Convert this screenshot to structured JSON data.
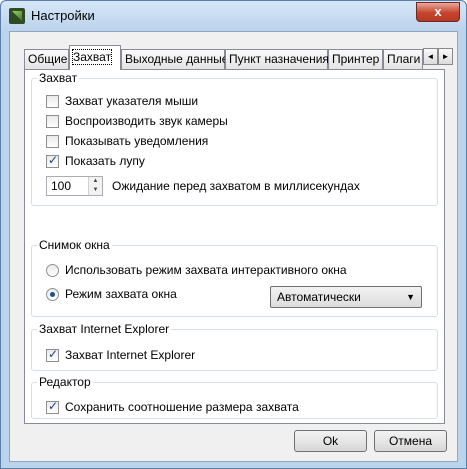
{
  "window": {
    "title": "Настройки",
    "close_glyph": "x"
  },
  "tabs": [
    "Общие",
    "Захват",
    "Выходные данные",
    "Пункт назначения",
    "Принтер",
    "Плаги"
  ],
  "tab_scroll": {
    "left": "◄",
    "right": "►"
  },
  "capture": {
    "label": "Захват",
    "options": [
      "Захват указателя мыши",
      "Воспроизводить звук камеры",
      "Показывать уведомления",
      "Показать лупу"
    ],
    "checked": [
      false,
      false,
      false,
      true
    ],
    "delay_value": "100",
    "delay_label": "Ожидание перед захватом в миллисекундах"
  },
  "window_capture": {
    "label": "Снимок окна",
    "radio1": "Использовать режим захвата интерактивного окна",
    "radio2": "Режим захвата окна",
    "mode_value": "Автоматически"
  },
  "ie_capture": {
    "label": "Захват Internet Explorer",
    "option": "Захват Internet Explorer"
  },
  "editor": {
    "label": "Редактор",
    "option": "Сохранить соотношение размера захвата"
  },
  "buttons": {
    "ok": "Ok",
    "cancel": "Отмена"
  }
}
